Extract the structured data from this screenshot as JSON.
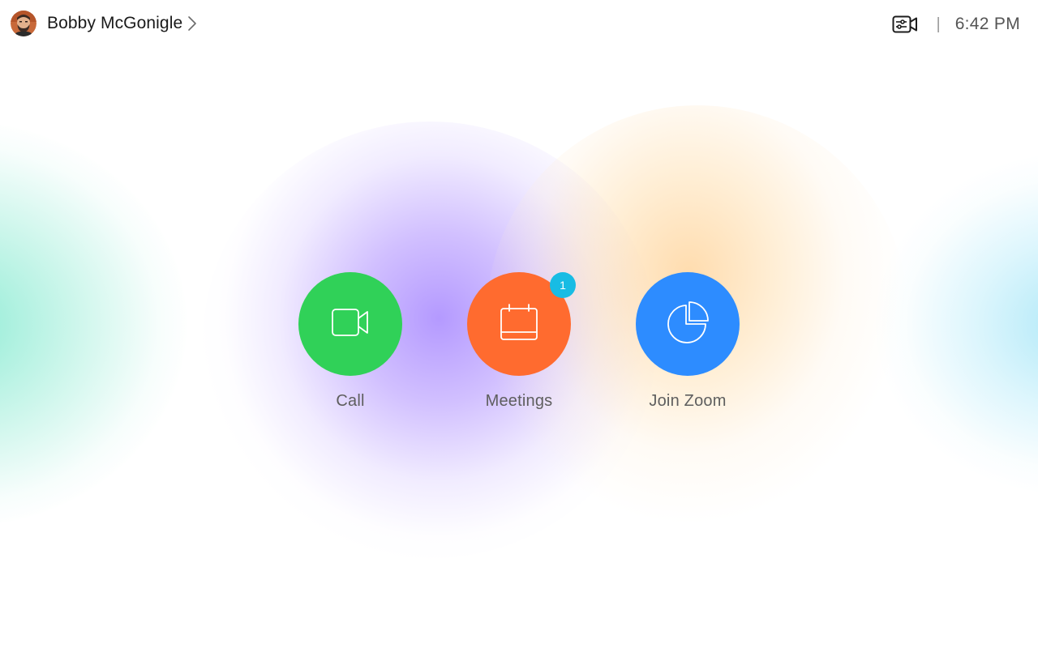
{
  "header": {
    "user_name": "Bobby McGonigle",
    "avatar_icon": "user-avatar",
    "chevron_icon": "chevron-right-icon",
    "status_icon": "video-settings-icon",
    "divider": "|",
    "time": "6:42 PM"
  },
  "actions": [
    {
      "label": "Call",
      "icon": "video-camera-icon",
      "color": "#30D158"
    },
    {
      "label": "Meetings",
      "icon": "calendar-icon",
      "color": "#FF6B2F",
      "badge": "1",
      "badge_color": "#18BCE4"
    },
    {
      "label": "Join Zoom",
      "icon": "zoom-pie-icon",
      "color": "#2D8CFF"
    }
  ],
  "colors": {
    "glow_left": "#8EEBD2",
    "glow_center": "#B094FF",
    "glow_right_center": "#FFD6A0",
    "glow_right": "#96E1F5"
  }
}
